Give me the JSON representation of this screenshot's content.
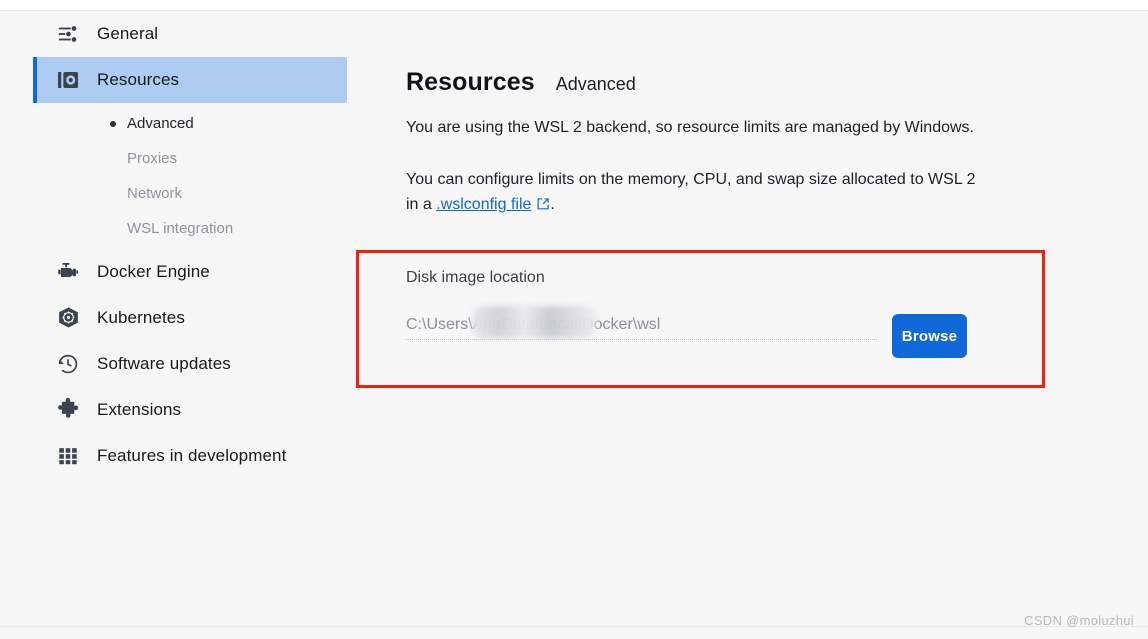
{
  "window": {
    "background_color": "#f7f7f8",
    "accent_color": "#1168d9",
    "highlight_color": "#aecbf2",
    "annotation_color": "#f71f0a"
  },
  "sidebar": {
    "items": [
      {
        "label": "General",
        "icon": "sliders-icon",
        "selected": false
      },
      {
        "label": "Resources",
        "icon": "disk-drive-icon",
        "selected": true
      },
      {
        "label": "Docker Engine",
        "icon": "engine-icon",
        "selected": false
      },
      {
        "label": "Kubernetes",
        "icon": "kubernetes-helm-icon",
        "selected": false
      },
      {
        "label": "Software updates",
        "icon": "history-clock-icon",
        "selected": false
      },
      {
        "label": "Extensions",
        "icon": "puzzle-piece-icon",
        "selected": false
      },
      {
        "label": "Features in development",
        "icon": "grid-icon",
        "selected": false
      }
    ],
    "sub_items": [
      {
        "label": "Advanced",
        "active": true
      },
      {
        "label": "Proxies",
        "active": false
      },
      {
        "label": "Network",
        "active": false
      },
      {
        "label": "WSL integration",
        "active": false
      }
    ]
  },
  "main": {
    "title": "Resources",
    "subtitle": "Advanced",
    "paragraph_1": "You are using the WSL 2 backend, so resource limits are managed by Windows.",
    "paragraph_2_before": "You can configure limits on the memory, CPU, and swap size allocated to WSL 2 in a ",
    "link_text": ".wslconfig file",
    "paragraph_2_after": ".",
    "disk_image": {
      "label": "Disk image location",
      "path_prefix": "C:\\Users",
      "path_suffix": "\\AppData\\Local\\Docker\\wsl",
      "redacted_note": "username blurred",
      "browse_label": "Browse"
    }
  },
  "watermark": {
    "text": "CSDN @moluzhui"
  }
}
